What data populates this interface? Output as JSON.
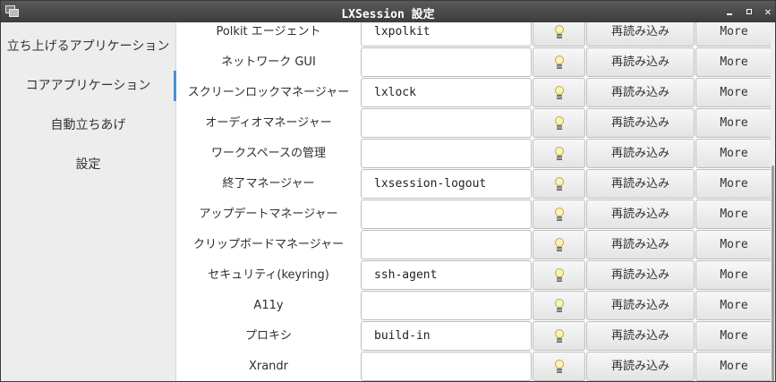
{
  "window": {
    "title": "LXSession 設定"
  },
  "sidebar": {
    "items": [
      {
        "label": "立ち上げるアプリケーション"
      },
      {
        "label": "コアアプリケーション",
        "active": true
      },
      {
        "label": "自動立ちあげ"
      },
      {
        "label": "設定"
      }
    ]
  },
  "core_apps": {
    "rows": [
      {
        "label": "Polkit エージェント",
        "value": "lxpolkit",
        "reload_label": "再読み込み",
        "more_label": "More"
      },
      {
        "label": "ネットワーク GUI",
        "value": "",
        "reload_label": "再読み込み",
        "more_label": "More"
      },
      {
        "label": "スクリーンロックマネージャー",
        "value": "lxlock",
        "reload_label": "再読み込み",
        "more_label": "More"
      },
      {
        "label": "オーディオマネージャー",
        "value": "",
        "reload_label": "再読み込み",
        "more_label": "More"
      },
      {
        "label": "ワークスペースの管理",
        "value": "",
        "reload_label": "再読み込み",
        "more_label": "More"
      },
      {
        "label": "終了マネージャー",
        "value": "lxsession-logout",
        "reload_label": "再読み込み",
        "more_label": "More"
      },
      {
        "label": "アップデートマネージャー",
        "value": "",
        "reload_label": "再読み込み",
        "more_label": "More"
      },
      {
        "label": "クリップボードマネージャー",
        "value": "",
        "reload_label": "再読み込み",
        "more_label": "More"
      },
      {
        "label": "セキュリティ(keyring)",
        "value": "ssh-agent",
        "reload_label": "再読み込み",
        "more_label": "More"
      },
      {
        "label": "A11y",
        "value": "",
        "reload_label": "再読み込み",
        "more_label": "More"
      },
      {
        "label": "プロキシ",
        "value": "build-in",
        "reload_label": "再読み込み",
        "more_label": "More"
      },
      {
        "label": "Xrandr",
        "value": "",
        "reload_label": "再読み込み",
        "more_label": "More"
      }
    ],
    "bulb_icon": "lightbulb-icon"
  },
  "colors": {
    "titlebar": "#3c3c3c",
    "active_accent": "#4a90d9",
    "content_bg": "#ffffff",
    "sidebar_bg": "#ededed"
  }
}
